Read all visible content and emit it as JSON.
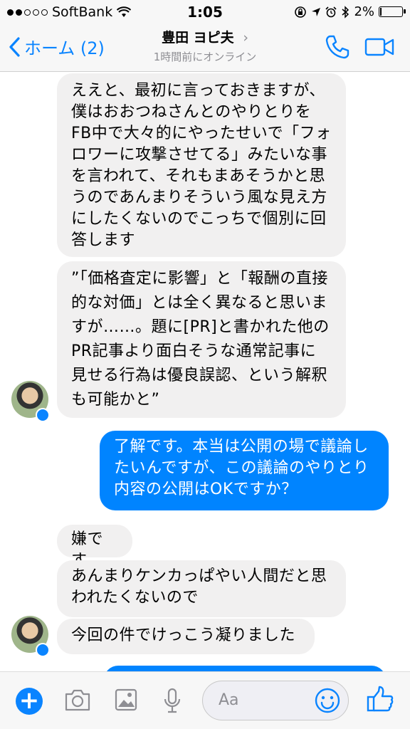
{
  "status_bar": {
    "carrier": "SoftBank",
    "time": "1:05",
    "battery": "2%",
    "battery_level": 0.02
  },
  "nav": {
    "back_label": "ホーム (2)",
    "contact_name": "豊田 ヨピ夫",
    "chevron": "›",
    "presence": "1時間前にオンライン"
  },
  "messages": [
    {
      "side": "in",
      "text": "ええと、最初に言っておきますが、僕はおおつねさんとのやりとりをFB中で大々的にやったせいで「フォロワーに攻撃させてる」みたいな事を言われて、それもまあそうかと思うのであんまりそういう風な見え方にしたくないのでこっちで個別に回答します"
    },
    {
      "side": "in",
      "text": "”「価格査定に影響」と「報酬の直接的な対価」とは全く異なると思いますが……。題に[PR]と書かれた他のPR記事より面白そうな通常記事に見せる行為は優良誤認、という解釈も可能かと”"
    },
    {
      "side": "out",
      "text": "了解です。本当は公開の場で議論したいんですが、この議論のやりとり内容の公開はOKですか？"
    },
    {
      "side": "in",
      "text": "嫌です"
    },
    {
      "side": "in",
      "text": "あんまりケンカっぱやい人間だと思われたくないので"
    },
    {
      "side": "in",
      "text": "今回の件でけっこう凝りました"
    }
  ],
  "composer": {
    "placeholder": "Aa",
    "icons": [
      "plus-icon",
      "camera-icon",
      "image-icon",
      "microphone-icon",
      "emoji-icon",
      "thumbs-up-icon"
    ]
  },
  "colors": {
    "accent": "#0a84ff",
    "outgoing_bubble": "#0084ff",
    "incoming_bubble": "#f1f0f0"
  }
}
